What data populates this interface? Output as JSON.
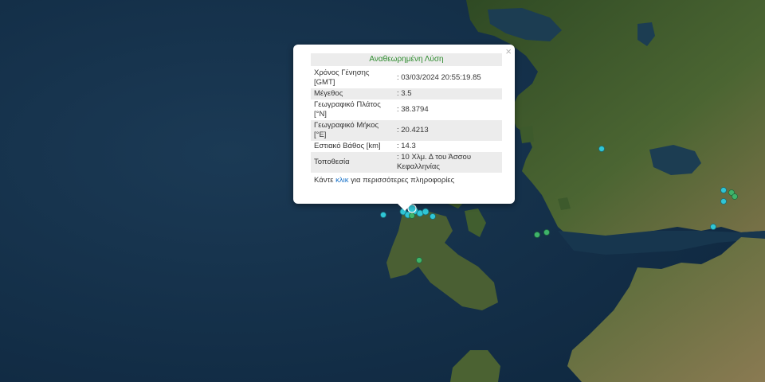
{
  "popup": {
    "title": "Αναθεωρημένη Λύση",
    "close_icon": "×",
    "rows": [
      {
        "label": "Χρόνος Γένησης [GMT]",
        "value": ": 03/03/2024 20:55:19.85"
      },
      {
        "label": "Μέγεθος",
        "value": ": 3.5"
      },
      {
        "label": "Γεωγραφικό Πλάτος [°N]",
        "value": ": 38.3794"
      },
      {
        "label": "Γεωγραφικό Μήκος [°E]",
        "value": ": 20.4213"
      },
      {
        "label": "Εστιακό Βάθος [km]",
        "value": ": 14.3"
      },
      {
        "label": "Τοποθεσία",
        "value": ": 10 Χλμ. Δ του Άσσου Κεφαλληνίας"
      }
    ],
    "more_prefix": "Κάντε ",
    "more_link": "κλικ",
    "more_suffix": " για περισσότερες πληροφορίες"
  },
  "colors": {
    "sea": "#13304a",
    "land": "#3e5a2c",
    "marker_cyan": "#2fc6d6",
    "marker_green": "#3fb36a",
    "title_green": "#2e8b2e",
    "link_blue": "#1a73c8"
  }
}
